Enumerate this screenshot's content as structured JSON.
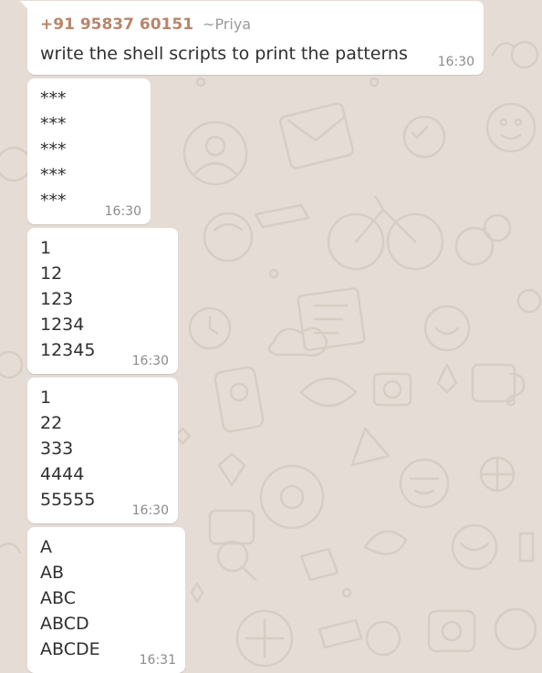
{
  "colors": {
    "background": "#e5ddd5",
    "bubble": "#ffffff",
    "sender_phone": "#b8866a",
    "sender_name": "#9a9a9a",
    "timestamp": "#8c8c8c"
  },
  "messages": [
    {
      "sender_phone": "+91 95837 60151",
      "sender_name": "~Priya",
      "text": "write the shell scripts to print the patterns",
      "time": "16:30"
    },
    {
      "lines": [
        "***",
        "***",
        "***",
        "***",
        "***"
      ],
      "time": "16:30"
    },
    {
      "lines": [
        "1",
        "12",
        "123",
        "1234",
        "12345"
      ],
      "time": "16:30"
    },
    {
      "lines": [
        "1",
        "22",
        "333",
        "4444",
        "55555"
      ],
      "time": "16:30"
    },
    {
      "lines": [
        "A",
        "AB",
        "ABC",
        "ABCD",
        "ABCDE"
      ],
      "time": "16:31"
    }
  ]
}
